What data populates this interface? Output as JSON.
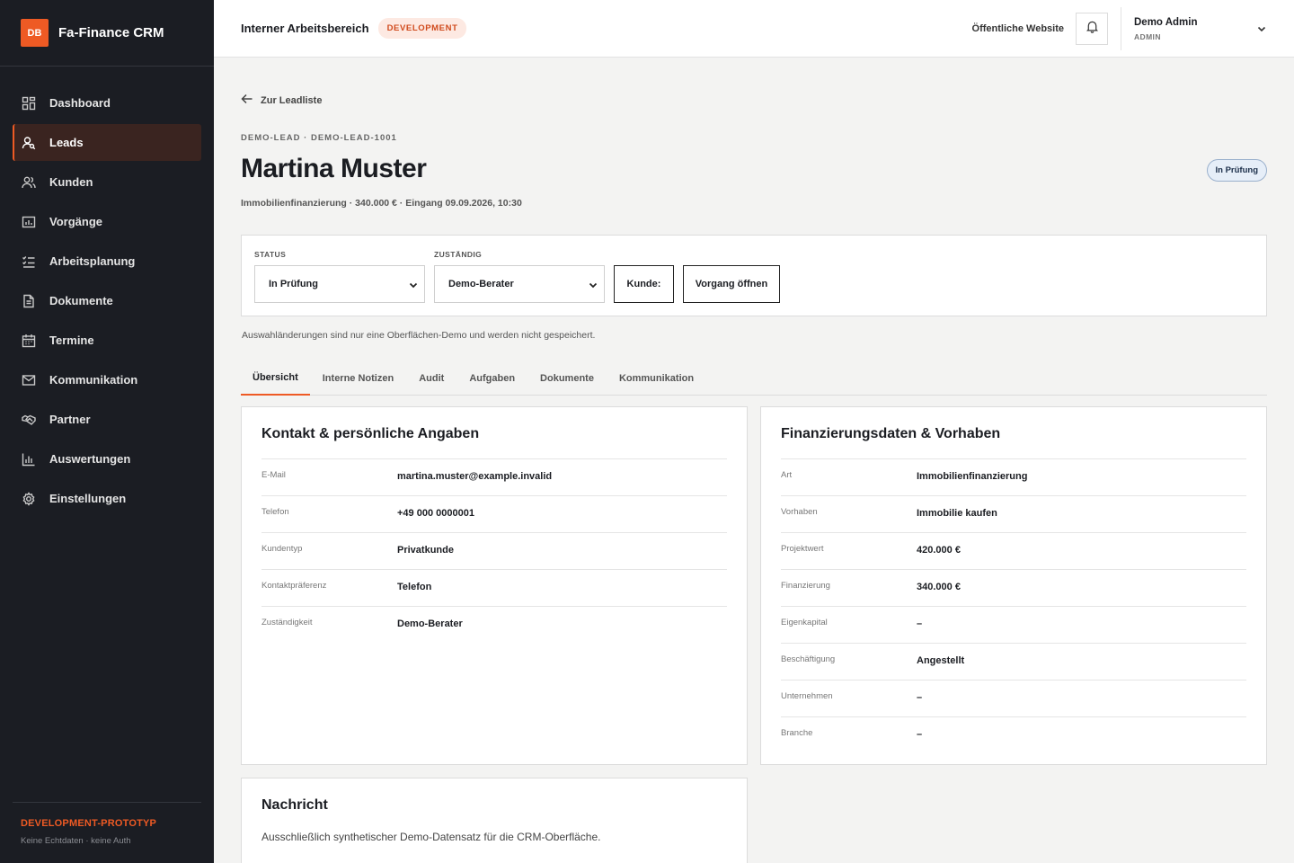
{
  "sidebar": {
    "logo": "DB",
    "app_name": "Fa-Finance CRM",
    "items": [
      {
        "label": "Dashboard",
        "icon": "dashboard-icon"
      },
      {
        "label": "Leads",
        "icon": "leads-icon",
        "active": true
      },
      {
        "label": "Kunden",
        "icon": "users-icon"
      },
      {
        "label": "Vorgänge",
        "icon": "folder-icon"
      },
      {
        "label": "Arbeitsplanung",
        "icon": "checklist-icon"
      },
      {
        "label": "Dokumente",
        "icon": "document-icon"
      },
      {
        "label": "Termine",
        "icon": "calendar-icon"
      },
      {
        "label": "Kommunikation",
        "icon": "mail-icon"
      },
      {
        "label": "Partner",
        "icon": "handshake-icon"
      },
      {
        "label": "Auswertungen",
        "icon": "bar-chart-icon"
      },
      {
        "label": "Einstellungen",
        "icon": "gear-icon"
      }
    ],
    "footer_title": "DEVELOPMENT-PROTOTYP",
    "footer_sub": "Keine Echtdaten · keine Auth"
  },
  "topbar": {
    "workspace": "Interner Arbeitsbereich",
    "env_badge": "DEVELOPMENT",
    "public_link": "Öffentliche Website",
    "user_name": "Demo Admin",
    "user_role": "ADMIN"
  },
  "lead": {
    "back_label": "Zur Leadliste",
    "breadcrumb": "DEMO-LEAD · DEMO-LEAD-1001",
    "name": "Martina Muster",
    "status_pill": "In Prüfung",
    "subline": "Immobilienfinanzierung · 340.000 € · Eingang 09.09.2026, 10:30"
  },
  "controls": {
    "status_label": "STATUS",
    "status_value": "In Prüfung",
    "owner_label": "ZUSTÄNDIG",
    "owner_value": "Demo-Berater",
    "customer_button": "Kunde:",
    "open_case_button": "Vorgang öffnen",
    "demo_note": "Auswahländerungen sind nur eine Oberflächen-Demo und werden nicht gespeichert."
  },
  "tabs": [
    "Übersicht",
    "Interne Notizen",
    "Audit",
    "Aufgaben",
    "Dokumente",
    "Kommunikation"
  ],
  "contact": {
    "title": "Kontakt & persönliche Angaben",
    "rows": [
      {
        "key": "E-Mail",
        "value": "martina.muster@example.invalid"
      },
      {
        "key": "Telefon",
        "value": "+49 000 0000001"
      },
      {
        "key": "Kundentyp",
        "value": "Privatkunde"
      },
      {
        "key": "Kontaktpräferenz",
        "value": "Telefon"
      },
      {
        "key": "Zuständigkeit",
        "value": "Demo-Berater"
      }
    ]
  },
  "financing": {
    "title": "Finanzierungsdaten & Vorhaben",
    "rows": [
      {
        "key": "Art",
        "value": "Immobilienfinanzierung"
      },
      {
        "key": "Vorhaben",
        "value": "Immobilie kaufen"
      },
      {
        "key": "Projektwert",
        "value": "420.000 €"
      },
      {
        "key": "Finanzierung",
        "value": "340.000 €"
      },
      {
        "key": "Eigenkapital",
        "value": "–"
      },
      {
        "key": "Beschäftigung",
        "value": "Angestellt"
      },
      {
        "key": "Unternehmen",
        "value": "–"
      },
      {
        "key": "Branche",
        "value": "–"
      }
    ]
  },
  "message": {
    "title": "Nachricht",
    "text": "Ausschließlich synthetischer Demo-Datensatz für die CRM-Oberfläche."
  },
  "colors": {
    "accent": "#ee5a24",
    "sidebar_bg": "#1b1d23",
    "page_bg": "#f3f3f2"
  }
}
